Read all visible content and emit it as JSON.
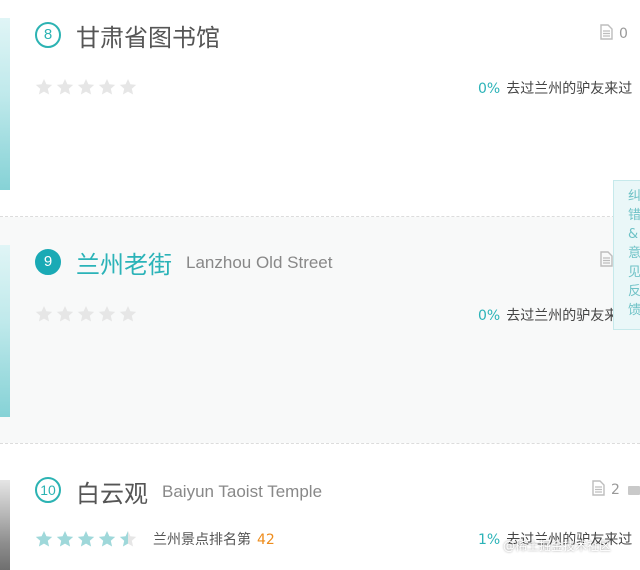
{
  "colors": {
    "accent": "#2bb3b8",
    "rank": "#ee8c1c",
    "star_on": "#9fd8da",
    "star_off": "#e6e6e6"
  },
  "items": [
    {
      "number": "8",
      "title_cn": "甘肃省图书馆",
      "title_en": "",
      "doc_count": "0",
      "rating": 0,
      "stat_percent": "0%",
      "stat_text": "去过兰州的驴友来过"
    },
    {
      "number": "9",
      "title_cn": "兰州老街",
      "title_en": "Lanzhou Old Street",
      "doc_count": "",
      "rating": 0,
      "stat_percent": "0%",
      "stat_text": "去过兰州的驴友来过"
    },
    {
      "number": "10",
      "title_cn": "白云观",
      "title_en": "Baiyun Taoist Temple",
      "doc_count": "2",
      "rating": 4.5,
      "rank_label": "兰州景点排名第",
      "rank_value": "42",
      "stat_percent": "1%",
      "stat_text": "去过兰州的驴友来过"
    }
  ],
  "feedback_tab": {
    "label": "纠\n错\n&\n意\n见\n反\n馈"
  },
  "watermark": "@稀土掘金技术社区",
  "icons": {
    "doc": "document-icon",
    "star": "star-icon"
  }
}
